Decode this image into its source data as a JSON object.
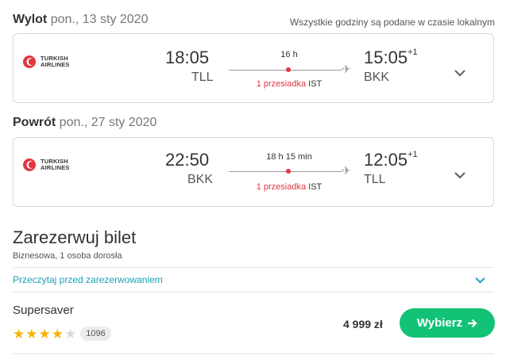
{
  "outbound": {
    "label": "Wylot",
    "date": "pon., 13 sty 2020",
    "timezone_note": "Wszystkie godziny są podane w czasie lokalnym",
    "airline_name": "TURKISH\nAIRLINES",
    "dep_time": "18:05",
    "dep_code": "TLL",
    "duration": "16 h",
    "stops": "1 przesiadka",
    "via": "IST",
    "arr_time": "15:05",
    "arr_offset": "+1",
    "arr_code": "BKK"
  },
  "return": {
    "label": "Powrót",
    "date": "pon., 27 sty 2020",
    "airline_name": "TURKISH\nAIRLINES",
    "dep_time": "22:50",
    "dep_code": "BKK",
    "duration": "18 h 15 min",
    "stops": "1 przesiadka",
    "via": "IST",
    "arr_time": "12:05",
    "arr_offset": "+1",
    "arr_code": "TLL"
  },
  "booking": {
    "title": "Zarezerwuj bilet",
    "subtitle": "Biznesowa, 1 osoba dorosła",
    "read_before_link": "Przeczytaj przed zarezerwowaniem"
  },
  "offer": {
    "provider": "Supersaver",
    "rating_stars": 4,
    "rating_max": 5,
    "reviews_count": "1096",
    "price": "4 999 zł",
    "select_label": "Wybierz",
    "button_color": "#12c276"
  },
  "colors": {
    "accent_red": "#e2363f",
    "link_teal": "#1aa1b5",
    "star_gold": "#f5b400"
  }
}
